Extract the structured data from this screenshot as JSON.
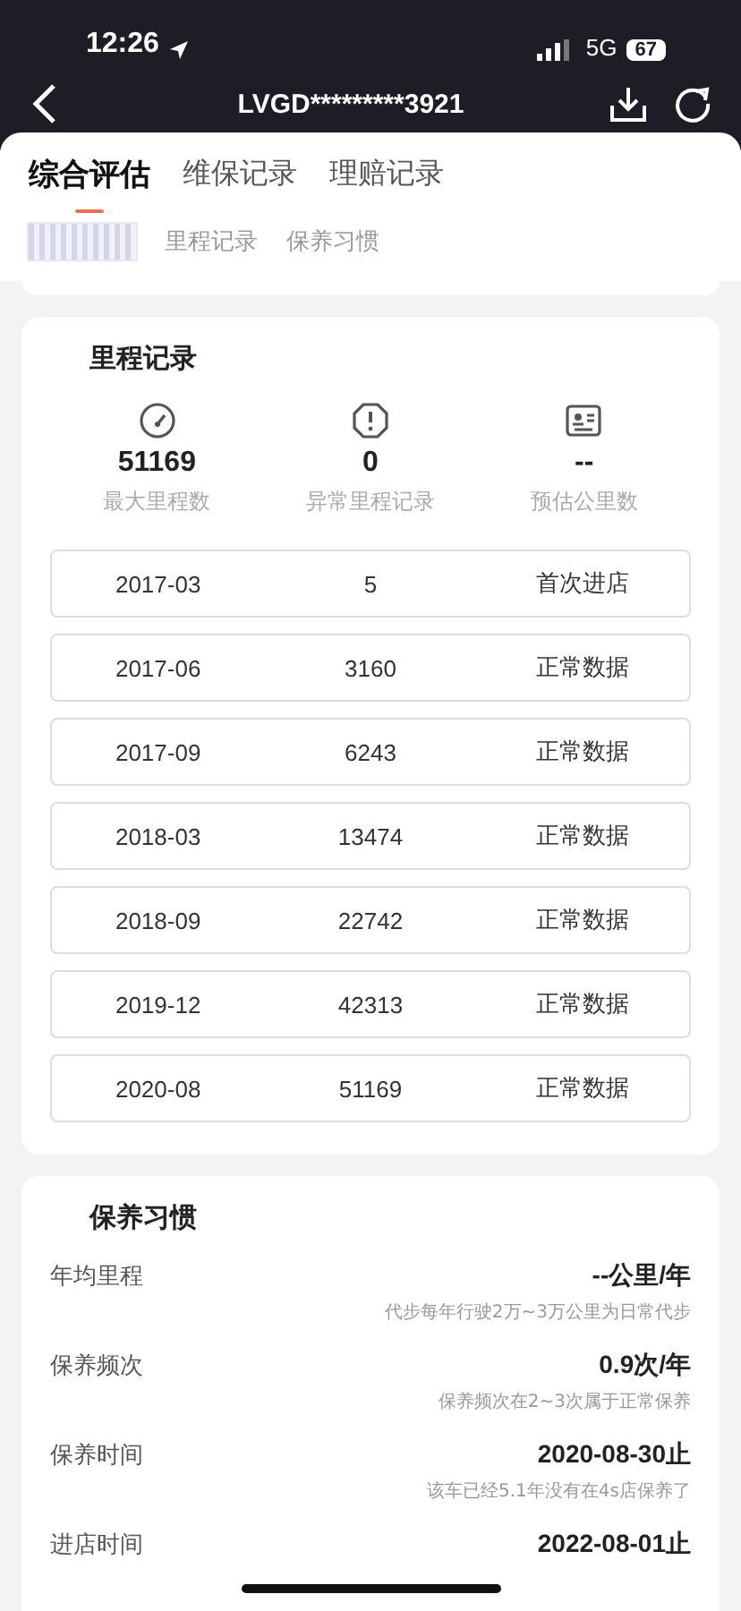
{
  "status_bar": {
    "time": "12:26",
    "network": "5G",
    "battery": "67"
  },
  "nav": {
    "title": "LVGD*********3921"
  },
  "tabs": [
    {
      "label": "综合评估",
      "selected": true
    },
    {
      "label": "维保记录",
      "selected": false
    },
    {
      "label": "理赔记录",
      "selected": false
    }
  ],
  "subtabs": [
    {
      "selected": true,
      "redacted": true
    },
    {
      "label": "里程记录",
      "selected": false,
      "redacted": false
    },
    {
      "label": "保养习惯",
      "selected": false,
      "redacted": false
    }
  ],
  "mileage": {
    "title": "里程记录",
    "stats": [
      {
        "kind": "gauge",
        "value": "51169",
        "label": "最大里程数"
      },
      {
        "kind": "alert",
        "value": "0",
        "label": "异常里程记录"
      },
      {
        "kind": "card",
        "value": "--",
        "label": "预估公里数"
      }
    ],
    "rows": [
      {
        "date": "2017-03",
        "mileage": "5",
        "status": "首次进店"
      },
      {
        "date": "2017-06",
        "mileage": "3160",
        "status": "正常数据"
      },
      {
        "date": "2017-09",
        "mileage": "6243",
        "status": "正常数据"
      },
      {
        "date": "2018-03",
        "mileage": "13474",
        "status": "正常数据"
      },
      {
        "date": "2018-09",
        "mileage": "22742",
        "status": "正常数据"
      },
      {
        "date": "2019-12",
        "mileage": "42313",
        "status": "正常数据"
      },
      {
        "date": "2020-08",
        "mileage": "51169",
        "status": "正常数据"
      }
    ]
  },
  "habits": {
    "title": "保养习惯",
    "items": [
      {
        "label": "年均里程",
        "value": "--公里/年",
        "note": "代步每年行驶2万~3万公里为日常代步"
      },
      {
        "label": "保养频次",
        "value": "0.9次/年",
        "note": "保养频次在2~3次属于正常保养"
      },
      {
        "label": "保养时间",
        "value": "2020-08-30止",
        "note": "该车已经5.1年没有在4s店保养了"
      },
      {
        "label": "进店时间",
        "value": "2022-08-01止"
      }
    ]
  }
}
